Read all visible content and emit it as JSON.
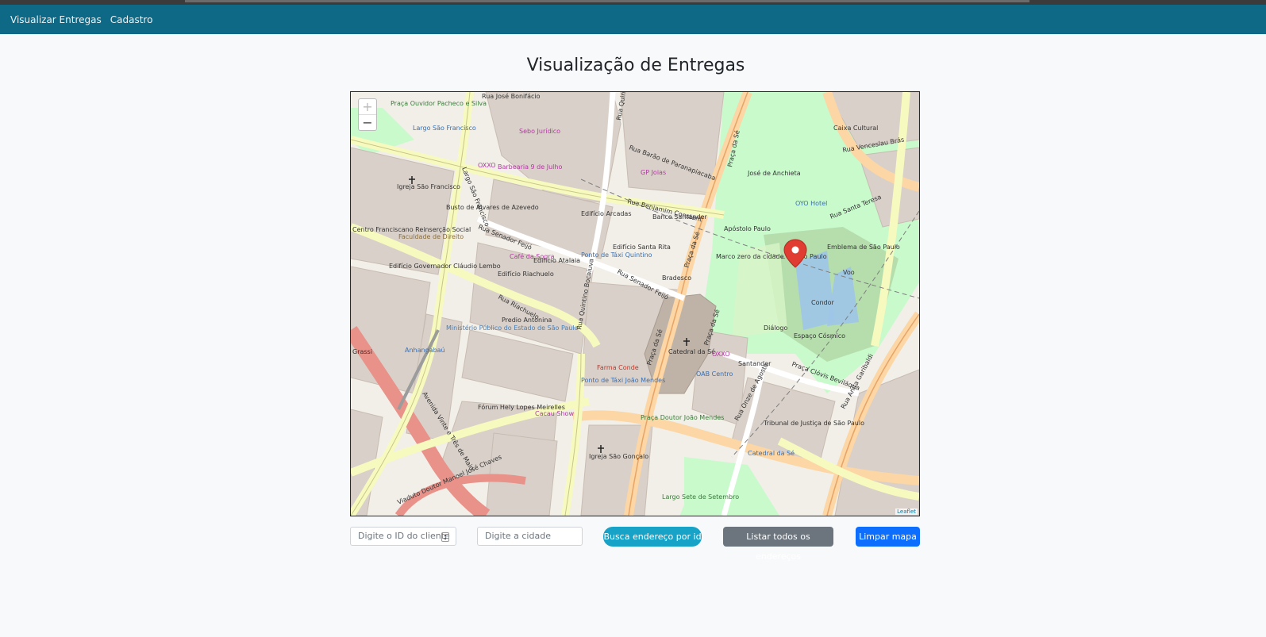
{
  "nav": {
    "items": [
      "Visualizar Entregas",
      "Cadastro"
    ]
  },
  "page": {
    "title": "Visualização de Entregas"
  },
  "map": {
    "zoom_in": "+",
    "zoom_out": "−",
    "attribution": "Leaflet",
    "marker_icon": "map-pin-icon",
    "labels": {
      "rua_jose_bonifacio": "Rua José Bonifácio",
      "rua_barao": "Rua Barão de Paranapiacaba",
      "rua_benjamin": "Rua Benjamim Constant",
      "rua_quintino": "Rua Quintino Bocaiuva",
      "rua_senador_feijo_1": "Rua Senador Feijó",
      "rua_senador_feijo_2": "Rua Senador Feijó",
      "rua_riachuelo": "Rua Riachuelo",
      "largo_sao_francisco": "Largo São Francisco",
      "praca_da_se_1": "Praça da Sé",
      "praca_da_se_2": "Praça da Sé",
      "praca_da_se_3": "Praça da Sé",
      "rua_venceslau": "Rua Venceslau Brás",
      "rua_santa_teresa": "Rua Santa Teresa",
      "praca_clovis": "Praça Clóvis Beviláqua",
      "rua_onze": "Rua Onze de Agosto",
      "rua_anita": "Rua Anita Garibaldi",
      "avenida_vinte": "Avenida Vinte e Três de Maio",
      "viaduto": "Viaduto Doutor Manoel José Chaves",
      "catedral": "Catedral da Sé",
      "faculdade": "Faculdade de Direito",
      "igreja_sao_francisco": "Igreja São Francisco",
      "forum": "Fórum Hely Lopes Meirelles",
      "tribunal": "Tribunal de Justiça de São Paulo",
      "ministerio": "Ministério Público do Estado de São Paulo",
      "predio_antonina": "Predio Antonina",
      "edificio_riachuelo": "Edifício Riachuelo",
      "edificio_atalaia": "Edifício Atalaia",
      "edificio_santa_rita": "Edifício Santa Rita",
      "edificio_arcadas": "Edifício Arcadas",
      "igreja_sao_goncalo": "Igreja São Gonçalo",
      "farma_conde": "Farma Conde",
      "caixa_cultural": "Caixa Cultural",
      "oyo_hotel": "OYO Hotel",
      "banco_santander": "Banco Santander",
      "santander": "Santander",
      "oxxo_1": "OXXO",
      "oxxo_2": "OXXO",
      "marco_zero": "Marco zero da cidade de São Paulo",
      "emblema": "Emblema de São Paulo",
      "apostolo": "Apóstolo Paulo",
      "jose_anchieta": "José de Anchieta",
      "condor": "Condor",
      "dialogo": "Diálogo",
      "espaco_cosmico": "Espaço Cósmico",
      "voo": "Voo",
      "cafe_sogra": "Café da Sogra",
      "cacau_show": "Cacau Show",
      "praca_ouvidor": "Praça Ouvidor Pacheco e Silva",
      "largo_sao_francisco_2": "Largo São Francisco",
      "busto": "Busto de Álvares de Azevedo",
      "anhangabau": "Anhangabaú",
      "praca_joao_mendes": "Praça Doutor João Mendes",
      "largo_sete": "Largo Sete de Setembro",
      "catedral_se_bus": "Catedral da Sé",
      "ponto_taxi_1": "Ponto de Táxi Quintino",
      "ponto_taxi_2": "Ponto de Táxi João Mendes",
      "gp_joias": "GP Joias",
      "sebo": "Sebo Jurídico",
      "barbearia": "Barbearia 9 de Julho",
      "rua_grassi": "Grassi",
      "edificio_governador": "Edifício Governador Cláudio Lembo",
      "centro_franciscano": "Centro Franciscano Reinserção Social",
      "oab": "OAB Centro",
      "bradesco": "Bradesco",
      "rua_quintino_2": "Rua Quintino Bocaiuva",
      "praca_se_4": "Praça da Sé"
    }
  },
  "controls": {
    "client_id_placeholder": "Digite o ID do cliente",
    "city_placeholder": "Digite a cidade",
    "search_button": "Busca endereço por id",
    "list_button": "Listar todos os endereços",
    "clear_button": "Limpar mapa"
  },
  "colors": {
    "navbar": "#0d6986",
    "primary": "#0d6efd",
    "info": "#17a2c7",
    "secondary": "#6c757d",
    "marker": "#e03c31",
    "park": "#c8facc"
  }
}
